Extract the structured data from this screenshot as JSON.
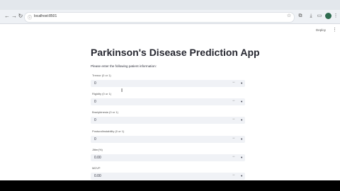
{
  "browser": {
    "url": "localhost:8501",
    "nav": {
      "back_icon": "←",
      "forward_icon": "→",
      "reload_icon": "↻",
      "info_icon": "ⓘ"
    },
    "toolbar_icons": [
      "star-icon",
      "extensions-icon",
      "download-icon",
      "profile-avatar",
      "menu-icon"
    ]
  },
  "app": {
    "deploy_label": "Deploy",
    "menu_icon": "⋮",
    "title": "Parkinson's Disease Prediction App",
    "subtitle": "Please enter the following patient information:",
    "fields": [
      {
        "label": "Tremor (0 or 1)",
        "value": "0"
      },
      {
        "label": "Rigidity (0 or 1)",
        "value": "0"
      },
      {
        "label": "Bradykinesia (0 or 1)",
        "value": "0"
      },
      {
        "label": "PosturalInstability (0 or 1)",
        "value": "0"
      },
      {
        "label": "Jitter(%)",
        "value": "0.00"
      },
      {
        "label": "MDVP",
        "value": "0.00"
      }
    ],
    "stepper_minus": "−",
    "stepper_caret": "▾"
  }
}
